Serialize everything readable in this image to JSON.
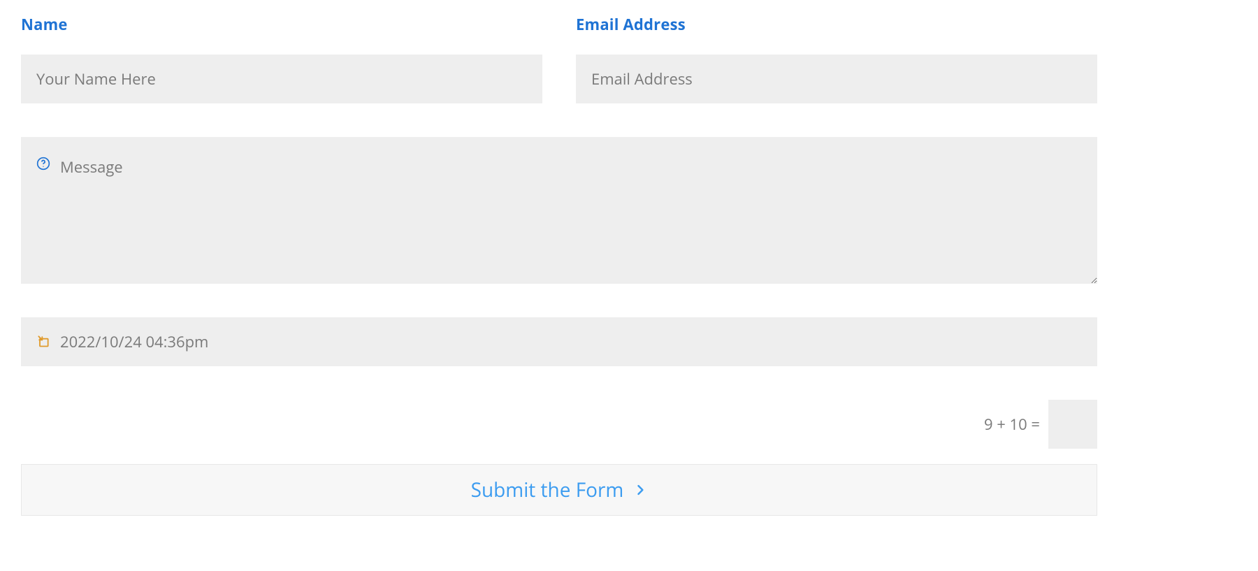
{
  "colors": {
    "label": "#1f73d4",
    "field_bg": "#eeeeee",
    "placeholder": "#7a7a7a",
    "submit_text": "#3c9cf0",
    "submit_bg": "#f7f7f7",
    "help_icon": "#1f73d4",
    "date_icon": "#e09b2d"
  },
  "form": {
    "name": {
      "label": "Name",
      "placeholder": "Your Name Here",
      "value": ""
    },
    "email": {
      "label": "Email Address",
      "placeholder": "Email Address",
      "value": ""
    },
    "message": {
      "placeholder": "Message",
      "value": "",
      "help_icon": "question-circle-icon"
    },
    "datetime": {
      "placeholder": "2022/10/24 04:36pm",
      "value": "",
      "icon": "calendar-arrow-icon"
    },
    "captcha": {
      "question": "9 + 10 =",
      "value": ""
    },
    "submit_label": "Submit the Form"
  }
}
